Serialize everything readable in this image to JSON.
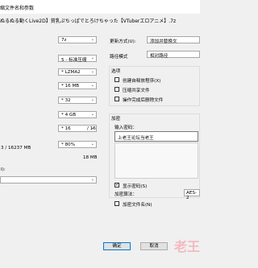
{
  "window": {
    "title": "缩文件名和参数",
    "path": "ぬるぬる動くLive2D】貧乳ぷちっぱでとろけちゃった【VTuberエロアニメ】.7z"
  },
  "left": {
    "format": "7z",
    "level": "5 - 标准压缩",
    "method": "* LZMA2",
    "dict": "* 16 MB",
    "word": "* 32",
    "block": "* 4 GB",
    "threads": "* 16",
    "threads_max": "/ 16",
    "memory_label": "3 / 16237 MB",
    "memory_pct": "* 80%",
    "decomp_mem": "18 MB",
    "split_label": "I):",
    "split_value": ""
  },
  "right": {
    "update_label": "更新方式(U):",
    "update_value": "添加并替换文",
    "path_mode_label": "路径模式",
    "path_mode_value": "相对路径",
    "options_title": "选项",
    "opt_sfx": "创建自释放程序(X)",
    "opt_shared": "压缩共享文件",
    "opt_delete": "操作完成后删除文件",
    "enc_title": "加密",
    "pwd_label": "输入密码：",
    "pwd_value": "上老王论坛当老王",
    "show_pwd": "显示密码(S)",
    "enc_method_label": "加密算法：",
    "enc_method_value": "AES-2",
    "enc_names": "加密文件名(N)"
  },
  "footer": {
    "ok": "确定",
    "cancel": "取消"
  },
  "watermark": "老王"
}
